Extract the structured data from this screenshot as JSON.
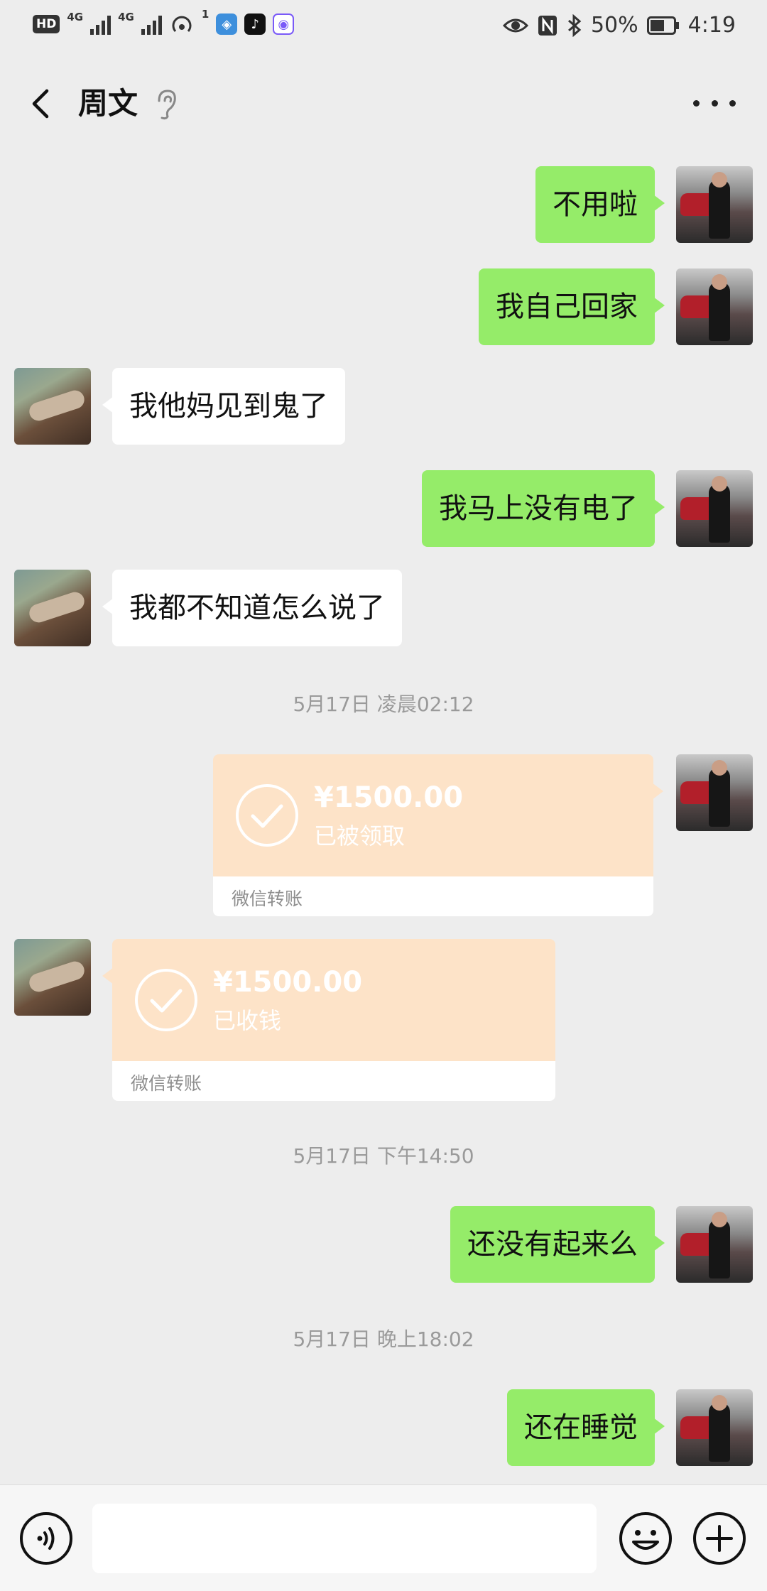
{
  "status_bar": {
    "hd": "HD",
    "network1": "4G",
    "network2": "4G",
    "hotspot_count": "1",
    "battery": "50%",
    "time": "4:19",
    "icons": [
      "eye-icon",
      "nfc-icon",
      "bluetooth-icon",
      "battery-icon"
    ]
  },
  "header": {
    "title": "周文"
  },
  "messages": [
    {
      "side": "out",
      "text": "不用啦"
    },
    {
      "side": "out",
      "text": "我自己回家"
    },
    {
      "side": "in",
      "text": "我他妈见到鬼了"
    },
    {
      "side": "out",
      "text": "我马上没有电了"
    },
    {
      "side": "in",
      "text": "我都不知道怎么说了"
    }
  ],
  "timestamps": [
    "5月17日 凌晨02:12",
    "5月17日 下午14:50",
    "5月17日 晚上18:02"
  ],
  "transfers": [
    {
      "side": "out",
      "amount": "¥1500.00",
      "status": "已被领取",
      "footer": "微信转账"
    },
    {
      "side": "in",
      "amount": "¥1500.00",
      "status": "已收钱",
      "footer": "微信转账"
    }
  ],
  "later_messages": [
    {
      "side": "out",
      "text": "还没有起来么"
    },
    {
      "side": "out",
      "text": "还在睡觉"
    }
  ],
  "input": {
    "value": "",
    "placeholder": ""
  },
  "colors": {
    "background": "#ededed",
    "outgoing_bubble": "#95ec69",
    "incoming_bubble": "#ffffff",
    "transfer_card": "#fde3c8"
  }
}
